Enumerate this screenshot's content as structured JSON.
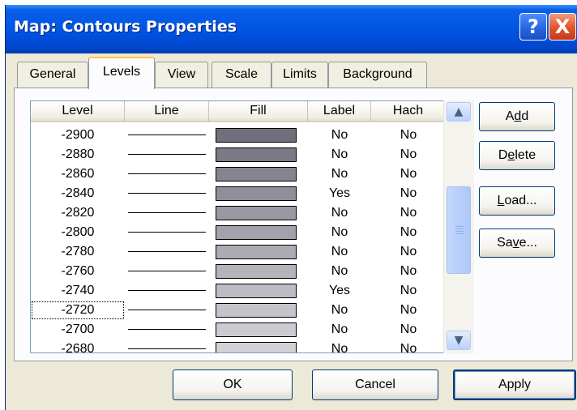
{
  "window": {
    "title": "Map: Contours Properties"
  },
  "title_buttons": {
    "help": "?",
    "close": "X"
  },
  "tabs": [
    "General",
    "Levels",
    "View",
    "Scale",
    "Limits",
    "Background"
  ],
  "active_tab": "Levels",
  "table": {
    "columns": [
      "Level",
      "Line",
      "Fill",
      "Label",
      "Hach"
    ],
    "rows": [
      {
        "level": "-2900",
        "fill": "#70707c",
        "label": "No",
        "hach": "No"
      },
      {
        "level": "-2880",
        "fill": "#7a7a86",
        "label": "No",
        "hach": "No"
      },
      {
        "level": "-2860",
        "fill": "#858590",
        "label": "No",
        "hach": "No"
      },
      {
        "level": "-2840",
        "fill": "#8f8f9a",
        "label": "Yes",
        "hach": "No"
      },
      {
        "level": "-2820",
        "fill": "#9999a3",
        "label": "No",
        "hach": "No"
      },
      {
        "level": "-2800",
        "fill": "#a2a2ac",
        "label": "No",
        "hach": "No"
      },
      {
        "level": "-2780",
        "fill": "#ababb4",
        "label": "No",
        "hach": "No"
      },
      {
        "level": "-2760",
        "fill": "#b4b4bc",
        "label": "No",
        "hach": "No"
      },
      {
        "level": "-2740",
        "fill": "#bcbcc4",
        "label": "Yes",
        "hach": "No"
      },
      {
        "level": "-2720",
        "fill": "#c4c4cb",
        "label": "No",
        "hach": "No"
      },
      {
        "level": "-2700",
        "fill": "#cbcbd2",
        "label": "No",
        "hach": "No"
      },
      {
        "level": "-2680",
        "fill": "#d1d1d8",
        "label": "No",
        "hach": "No"
      }
    ],
    "focused_level": "-2720"
  },
  "side_buttons": {
    "add": {
      "before": "A",
      "mnemonic": "d",
      "after": "d"
    },
    "delete": {
      "before": "D",
      "mnemonic": "e",
      "after": "lete"
    },
    "load": {
      "before": "",
      "mnemonic": "L",
      "after": "oad..."
    },
    "save": {
      "before": "Sa",
      "mnemonic": "v",
      "after": "e..."
    }
  },
  "footer_buttons": {
    "ok": "OK",
    "cancel": "Cancel",
    "apply": "Apply"
  },
  "icons": {
    "scroll_up": "chevron-up-icon",
    "scroll_down": "chevron-down-icon"
  },
  "colors": {
    "titlebar": "#0055e5",
    "dialog_bg": "#ece9d8",
    "close_button": "#e0542b",
    "active_tab_accent": "#ffc83c"
  }
}
